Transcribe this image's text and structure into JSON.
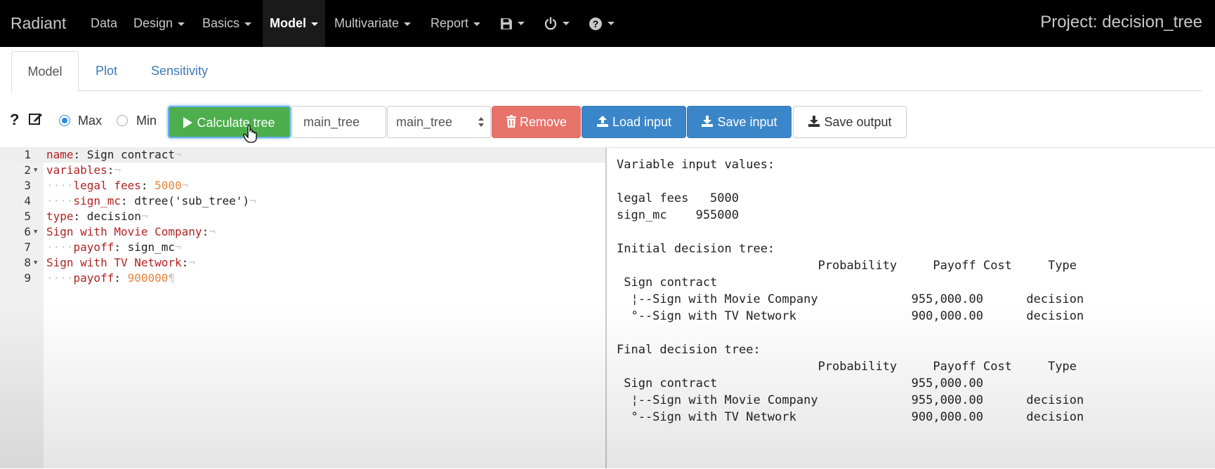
{
  "navbar": {
    "brand": "Radiant",
    "items": [
      {
        "label": "Data",
        "caret": false
      },
      {
        "label": "Design",
        "caret": true
      },
      {
        "label": "Basics",
        "caret": true
      },
      {
        "label": "Model",
        "caret": true,
        "active": true
      },
      {
        "label": "Multivariate",
        "caret": true
      },
      {
        "label": "Report",
        "caret": true
      }
    ],
    "icons": [
      "save-icon",
      "power-icon",
      "help-circle-icon"
    ],
    "project": "Project: decision_tree"
  },
  "tabs": [
    {
      "label": "Model",
      "active": true
    },
    {
      "label": "Plot",
      "active": false
    },
    {
      "label": "Sensitivity",
      "active": false
    }
  ],
  "toolbar": {
    "help": "?",
    "radio_max": "Max",
    "radio_min": "Min",
    "selected": "Max",
    "calculate": "Calculate tree",
    "tree_name_input": "main_tree",
    "tree_select": "main_tree",
    "remove": "Remove",
    "load_input": "Load input",
    "save_input": "Save input",
    "save_output": "Save output"
  },
  "editor": {
    "line_numbers": [
      "1",
      "2",
      "3",
      "4",
      "5",
      "6",
      "7",
      "8",
      "9"
    ],
    "lines": [
      {
        "indent": "",
        "key": "name",
        "value": " Sign contract",
        "vtype": "text",
        "eol": "¬"
      },
      {
        "indent": "",
        "key": "variables",
        "value": "",
        "vtype": "text",
        "eol": "¬"
      },
      {
        "indent": "····",
        "key": "legal fees",
        "value": " 5000",
        "vtype": "num",
        "eol": "¬"
      },
      {
        "indent": "····",
        "key": "sign_mc",
        "value": " dtree('sub_tree')",
        "vtype": "text",
        "eol": "¬"
      },
      {
        "indent": "",
        "key": "type",
        "value": " decision",
        "vtype": "text",
        "eol": "¬"
      },
      {
        "indent": "",
        "key": "Sign with Movie Company",
        "value": "",
        "vtype": "text",
        "eol": "¬"
      },
      {
        "indent": "····",
        "key": "payoff",
        "value": " sign_mc",
        "vtype": "text",
        "eol": "¬"
      },
      {
        "indent": "",
        "key": "Sign with TV Network",
        "value": "",
        "vtype": "text",
        "eol": "¬"
      },
      {
        "indent": "····",
        "key": "payoff",
        "value": " 900000",
        "vtype": "num",
        "eol": "¶"
      }
    ]
  },
  "output": {
    "lines": [
      "Variable input values:",
      "",
      "legal fees   5000",
      "sign_mc    955000",
      "",
      "Initial decision tree:",
      "                            Probability     Payoff Cost     Type",
      " Sign contract",
      "  ¦--Sign with Movie Company             955,000.00      decision",
      "  °--Sign with TV Network                900,000.00      decision",
      "",
      "Final decision tree:",
      "                            Probability     Payoff Cost     Type",
      " Sign contract                           955,000.00",
      "  ¦--Sign with Movie Company             955,000.00      decision",
      "  °--Sign with TV Network                900,000.00      decision"
    ]
  },
  "colors": {
    "navbar_bg": "#000000",
    "calculate_bg": "#4cae4c",
    "remove_bg": "#e8736b",
    "primary_bg": "#3b86c9",
    "tab_link": "#3c7bb7"
  }
}
